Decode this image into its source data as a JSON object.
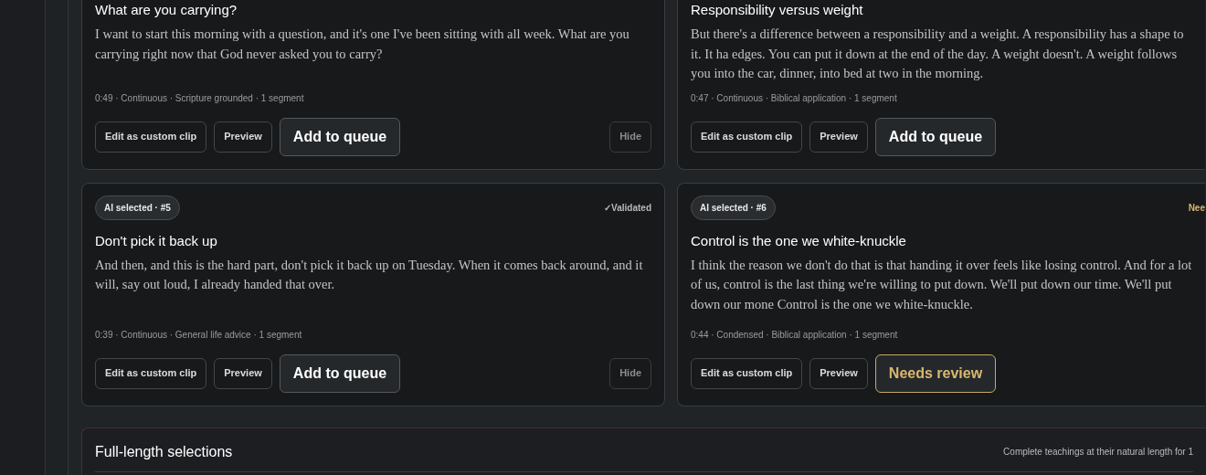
{
  "clips": [
    {
      "title": "What are you carrying?",
      "text": "I want to start this morning with a question, and it's one I've been sitting with all week. What are you carrying right now that God never asked you to carry?",
      "meta": "0:49 · Continuous · Scripture grounded · 1 segment",
      "buttons": [
        {
          "kind": "secondary",
          "label": "Edit as custom clip"
        },
        {
          "kind": "secondary",
          "label": "Preview"
        },
        {
          "kind": "queue",
          "label": "Add to queue"
        },
        {
          "kind": "hide",
          "label": "Hide"
        }
      ]
    },
    {
      "title": "Responsibility versus weight",
      "text": "But there's a difference between a responsibility and a weight. A responsibility has a shape to it. It ha edges. You can put it down at the end of the day. A weight doesn't. A weight follows you into the car, dinner, into bed at two in the morning.",
      "meta": "0:47 · Continuous · Biblical application · 1 segment",
      "buttons": [
        {
          "kind": "secondary",
          "label": "Edit as custom clip"
        },
        {
          "kind": "secondary",
          "label": "Preview"
        },
        {
          "kind": "queue",
          "label": "Add to queue"
        }
      ]
    },
    {
      "badge": "AI selected · #5",
      "status": {
        "kind": "validated",
        "label": "✓Validated"
      },
      "title": "Don't pick it back up",
      "text": "And then, and this is the hard part, don't pick it back up on Tuesday. When it comes back around, and it will, say out loud, I already handed that over.",
      "meta": "0:39 · Continuous · General life advice · 1 segment",
      "buttons": [
        {
          "kind": "secondary",
          "label": "Edit as custom clip"
        },
        {
          "kind": "secondary",
          "label": "Preview"
        },
        {
          "kind": "queue",
          "label": "Add to queue"
        },
        {
          "kind": "hide",
          "label": "Hide"
        }
      ]
    },
    {
      "badge": "AI selected · #6",
      "status": {
        "kind": "review",
        "label": "Nee"
      },
      "title": "Control is the one we white-knuckle",
      "text": "I think the reason we don't do that is that handing it over feels like losing control. And for a lot of us, control is the last thing we're willing to put down. We'll put down our time. We'll put down our mone Control is the one we white-knuckle.",
      "meta": "0:44 · Condensed · Biblical application · 1 segment",
      "buttons": [
        {
          "kind": "secondary",
          "label": "Edit as custom clip"
        },
        {
          "kind": "secondary",
          "label": "Preview"
        },
        {
          "kind": "review",
          "label": "Needs review"
        }
      ]
    }
  ],
  "section": {
    "title": "Full-length selections",
    "subtitle": "Complete teachings at their natural length for 1"
  }
}
